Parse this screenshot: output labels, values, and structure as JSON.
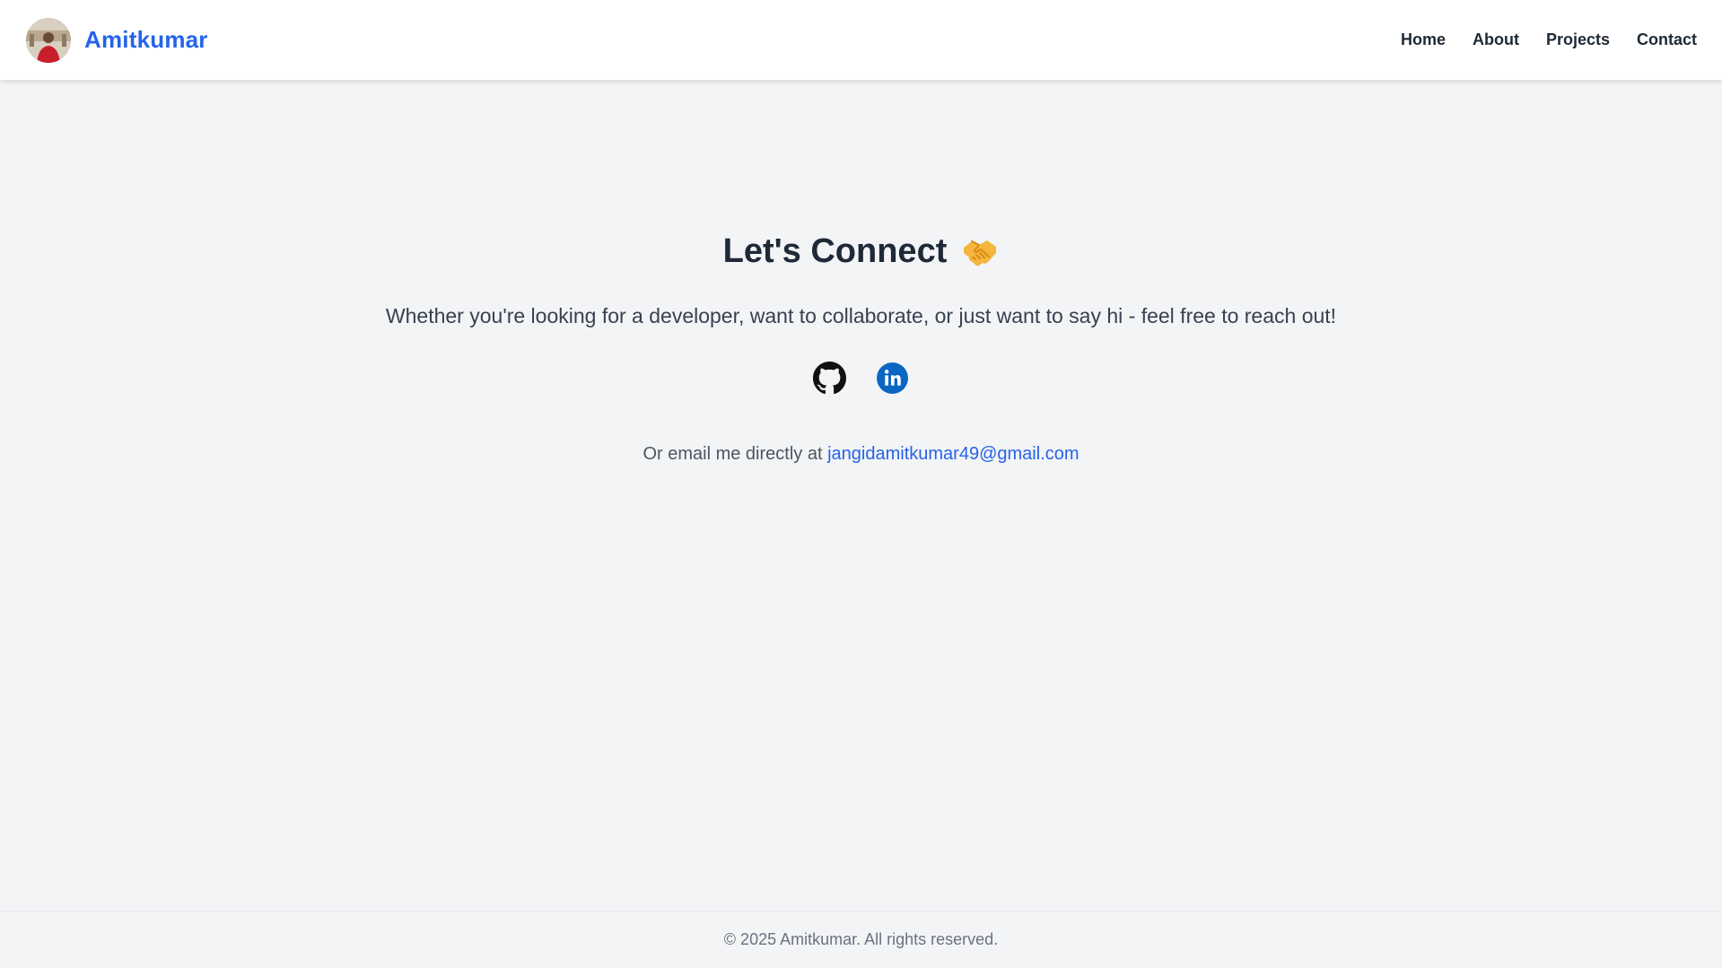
{
  "header": {
    "brand_name": "Amitkumar",
    "nav": [
      {
        "label": "Home"
      },
      {
        "label": "About"
      },
      {
        "label": "Projects"
      },
      {
        "label": "Contact"
      }
    ]
  },
  "contact": {
    "title": "Let's Connect",
    "title_icon": "handshake-icon",
    "subtitle": "Whether you're looking for a developer, want to collaborate, or just want to say hi - feel free to reach out!",
    "socials": [
      {
        "icon": "github-icon"
      },
      {
        "icon": "linkedin-icon"
      }
    ],
    "email_prefix": "Or email me directly at",
    "email": "jangidamitkumar49@gmail.com"
  },
  "footer": {
    "text": "© 2025 Amitkumar. All rights reserved."
  },
  "colors": {
    "accent": "#2563eb",
    "background": "#f3f4f6",
    "linkedin": "#0a66c2"
  }
}
